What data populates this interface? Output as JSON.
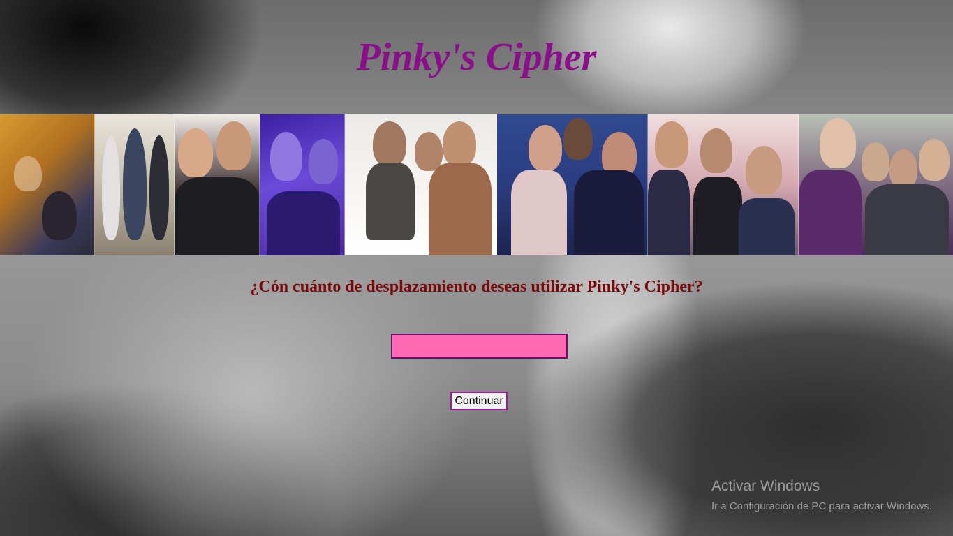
{
  "page": {
    "title": "Pinky's Cipher",
    "question": "¿Cón cuánto de desplazamiento deseas utilizar Pinky's Cipher?",
    "shift_input": {
      "value": "",
      "placeholder": ""
    },
    "continue_label": "Continuar"
  },
  "photo_strip": {
    "photos": [
      {
        "name": "photo-group-sofa",
        "tone": "#c58a2a"
      },
      {
        "name": "photo-group-standing",
        "tone": "#b7b09a"
      },
      {
        "name": "photo-selfie-two",
        "tone": "#3c3232"
      },
      {
        "name": "photo-selfie-purple",
        "tone": "#5a3cc8"
      },
      {
        "name": "photo-group-table",
        "tone": "#d8d4d0"
      },
      {
        "name": "photo-group-club",
        "tone": "#3c5aa0"
      },
      {
        "name": "photo-group-party",
        "tone": "#c49aa0"
      },
      {
        "name": "photo-group-outdoor",
        "tone": "#6a4a7a"
      }
    ]
  },
  "watermark": {
    "title": "Activar Windows",
    "subtitle": "Ir a Configuración de PC para activar Windows."
  },
  "colors": {
    "title": "#8b0f8b",
    "question": "#7a0a0a",
    "input_background": "#ff69b4",
    "input_border": "#6b0f6b",
    "button_border": "#a01aa0"
  }
}
